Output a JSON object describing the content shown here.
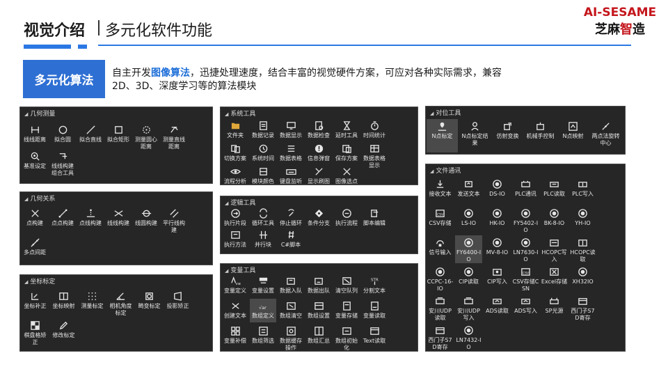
{
  "header": {
    "title": "视觉介绍",
    "subtitle": "多元化软件功能",
    "brand_en": "AI-SESAME",
    "brand_cn_1": "芝麻",
    "brand_cn_2": "智",
    "brand_cn_3": "造"
  },
  "banner": {
    "badge": "多元化算法",
    "desc_1": "自主开发",
    "desc_hl": "图像算法",
    "desc_2": "，迅捷处理速度，结合丰富的视觉硬件方案，可应对各种实际需求，兼容2D、3D、深度学习等的算法模块"
  },
  "panels": [
    {
      "id": "geometry-measure",
      "title": "几何测量",
      "tools": [
        {
          "label": "线线距离",
          "icon": "line-distance-icon"
        },
        {
          "label": "拟合圆",
          "icon": "circle-icon"
        },
        {
          "label": "拟合直线",
          "icon": "line-icon"
        },
        {
          "label": "拟合矩形",
          "icon": "rect-icon"
        },
        {
          "label": "测量圆心距离",
          "icon": "circle-center-icon"
        },
        {
          "label": "测量直线距离",
          "icon": "measure-icon"
        },
        {
          "label": "基准设定",
          "icon": "target-icon"
        },
        {
          "label": "线线构建组合工具",
          "icon": "build-icon"
        }
      ]
    },
    {
      "id": "geometry-relation",
      "title": "几何关系",
      "tools": [
        {
          "label": "点构建",
          "icon": "cross-icon"
        },
        {
          "label": "点点构建",
          "icon": "point-point-icon"
        },
        {
          "label": "点线构建",
          "icon": "point-line-icon"
        },
        {
          "label": "线线构建",
          "icon": "line-line-icon"
        },
        {
          "label": "线圆构建",
          "icon": "line-circle-icon"
        },
        {
          "label": "平行线构建",
          "icon": "parallel-icon"
        },
        {
          "label": "多点间距",
          "icon": "multi-point-icon"
        }
      ]
    },
    {
      "id": "coord-calib",
      "title": "坐标标定",
      "tools": [
        {
          "label": "坐标补正",
          "icon": "coord-icon"
        },
        {
          "label": "坐标映射",
          "icon": "map-icon"
        },
        {
          "label": "测量标定",
          "icon": "grid-icon"
        },
        {
          "label": "相机角度标定",
          "icon": "angle-icon"
        },
        {
          "label": "畸变标定",
          "icon": "distort-icon"
        },
        {
          "label": "投影矫正",
          "icon": "projection-icon"
        },
        {
          "label": "棋盘格矫正",
          "icon": "checker-icon"
        },
        {
          "label": "修改标定",
          "icon": "edit-icon"
        }
      ]
    },
    {
      "id": "system-tools",
      "title": "系统工具",
      "tools": [
        {
          "label": "文件夹",
          "icon": "folder-icon"
        },
        {
          "label": "数据记录",
          "icon": "record-icon"
        },
        {
          "label": "数据显示",
          "icon": "display-icon"
        },
        {
          "label": "数据检查",
          "icon": "check-icon"
        },
        {
          "label": "延时工具",
          "icon": "hourglass-icon"
        },
        {
          "label": "时间统计",
          "icon": "timer-icon"
        },
        {
          "label": "切换方案",
          "icon": "switch-icon"
        },
        {
          "label": "系统时间",
          "icon": "clock-icon"
        },
        {
          "label": "数据表格",
          "icon": "list-icon"
        },
        {
          "label": "信息弹窗",
          "icon": "alert-icon"
        },
        {
          "label": "保存方案",
          "icon": "save-icon"
        },
        {
          "label": "数据表格显示",
          "icon": "table-icon"
        },
        {
          "label": "流程分析",
          "icon": "eye-icon"
        },
        {
          "label": "模块颜色",
          "icon": "color-icon"
        },
        {
          "label": "键盘监听",
          "icon": "keyboard-icon"
        },
        {
          "label": "显示刷图",
          "icon": "refresh-icon"
        },
        {
          "label": "图像选点",
          "icon": "pick-icon"
        }
      ]
    },
    {
      "id": "logic-tools",
      "title": "逻辑工具",
      "tools": [
        {
          "label": "执行片段",
          "icon": "run-icon"
        },
        {
          "label": "循环工具",
          "icon": "loop-icon"
        },
        {
          "label": "停止循环",
          "icon": "stop-loop-icon"
        },
        {
          "label": "条件分支",
          "icon": "branch-icon"
        },
        {
          "label": "执行流程",
          "icon": "flow-icon"
        },
        {
          "label": "脚本编辑",
          "icon": "script-icon"
        },
        {
          "label": "执行方法",
          "icon": "method-icon"
        },
        {
          "label": "并行块",
          "icon": "parallel-block-icon"
        },
        {
          "label": "C#脚本",
          "icon": "csharp-icon"
        }
      ]
    },
    {
      "id": "variable-tools",
      "title": "变量工具",
      "tools": [
        {
          "label": "变量定义",
          "icon": "var-icon"
        },
        {
          "label": "变量设置",
          "icon": "var-set-icon"
        },
        {
          "label": "数据入队",
          "icon": "queue-in-icon"
        },
        {
          "label": "数据出队",
          "icon": "queue-out-icon"
        },
        {
          "label": "清空队列",
          "icon": "queue-clear-icon"
        },
        {
          "label": "分割文本",
          "icon": "split-icon"
        },
        {
          "label": "创建文本",
          "icon": "text-icon"
        },
        {
          "label": "数组定义",
          "icon": "array-icon",
          "selected": true
        },
        {
          "label": "数组清空",
          "icon": "array-clear-icon"
        },
        {
          "label": "数组设置",
          "icon": "array-set-icon"
        },
        {
          "label": "变量存储",
          "icon": "var-save-icon"
        },
        {
          "label": "变量读取",
          "icon": "var-read-icon"
        },
        {
          "label": "变量补偿",
          "icon": "var-comp-icon"
        },
        {
          "label": "数组筛选",
          "icon": "filter-icon"
        },
        {
          "label": "数据缓存操作",
          "icon": "cache-icon"
        },
        {
          "label": "数组汇总",
          "icon": "sum-icon"
        },
        {
          "label": "数组初始化",
          "icon": "init-icon"
        },
        {
          "label": "Text读取",
          "icon": "text-read-icon"
        }
      ]
    },
    {
      "id": "align-tools",
      "title": "对位工具",
      "tools": [
        {
          "label": "N点标定",
          "icon": "npoint-icon",
          "selected": true
        },
        {
          "label": "N点标定结果",
          "icon": "npoint-result-icon"
        },
        {
          "label": "仿射变换",
          "icon": "affine-icon"
        },
        {
          "label": "机械手控制",
          "icon": "robot-icon"
        },
        {
          "label": "N点映射",
          "icon": "npoint-map-icon"
        },
        {
          "label": "两点法旋转中心",
          "icon": "rotate-icon"
        }
      ]
    },
    {
      "id": "file-comm",
      "title": "文件通讯",
      "tools": [
        {
          "label": "接收文本",
          "icon": "receive-icon"
        },
        {
          "label": "发送文本",
          "icon": "send-icon"
        },
        {
          "label": "DS-IO",
          "icon": "io-icon"
        },
        {
          "label": "PLC通讯",
          "icon": "plc-icon"
        },
        {
          "label": "PLC读取",
          "icon": "plc-read-icon"
        },
        {
          "label": "PLC写入",
          "icon": "plc-write-icon"
        },
        {
          "label": "CSV存储",
          "icon": "csv-icon"
        },
        {
          "label": "LS-IO",
          "icon": "io-icon"
        },
        {
          "label": "HK-IO",
          "icon": "io-icon"
        },
        {
          "label": "FY5402-IO",
          "icon": "io-icon"
        },
        {
          "label": "BK-8-IO",
          "icon": "io-icon"
        },
        {
          "label": "YH-IO",
          "icon": "io-icon"
        },
        {
          "label": "信号输入",
          "icon": "signal-icon"
        },
        {
          "label": "FY6400-IO",
          "icon": "io-icon",
          "selected": true
        },
        {
          "label": "MV-8-IO",
          "icon": "io-icon"
        },
        {
          "label": "LN7630-IO",
          "icon": "io-icon"
        },
        {
          "label": "HCOPC写入",
          "icon": "opc-write-icon"
        },
        {
          "label": "HCOPC读取",
          "icon": "opc-read-icon"
        },
        {
          "label": "CCPC-16-IO",
          "icon": "io-icon"
        },
        {
          "label": "CIP读取",
          "icon": "io-icon"
        },
        {
          "label": "CIP写入",
          "icon": "cip-write-icon"
        },
        {
          "label": "CSV存储CSN",
          "icon": "csv-icon"
        },
        {
          "label": "Excel存储",
          "icon": "excel-icon"
        },
        {
          "label": "XH32IO",
          "icon": "io-icon"
        },
        {
          "label": "安川UDP读取",
          "icon": "udp-icon"
        },
        {
          "label": "安川UDP写入",
          "icon": "udp-icon"
        },
        {
          "label": "ADS读取",
          "icon": "ads-icon"
        },
        {
          "label": "ADS写入",
          "icon": "ads-icon"
        },
        {
          "label": "SP光源",
          "icon": "light-icon"
        },
        {
          "label": "西门子S7D寄存",
          "icon": "siemens-icon"
        },
        {
          "label": "西门子S7D寄存",
          "icon": "siemens-icon"
        },
        {
          "label": "LN7432-IO",
          "icon": "io-icon"
        }
      ]
    }
  ]
}
